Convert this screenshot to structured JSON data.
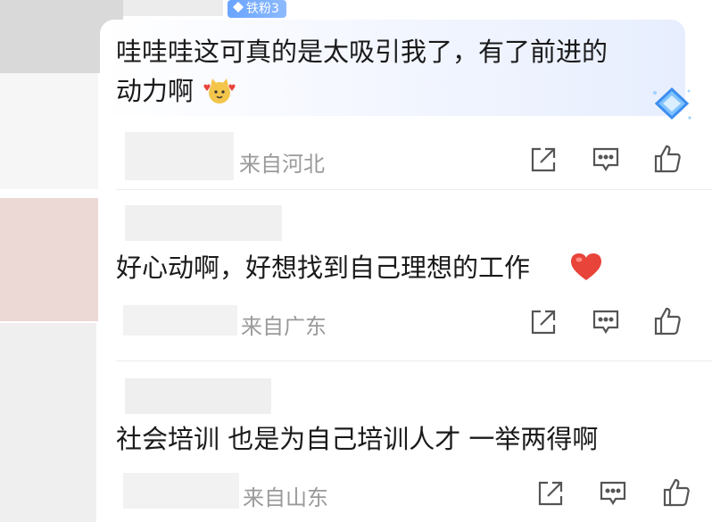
{
  "comments": [
    {
      "badge": "铁粉3",
      "text_line1": "哇哇哇这可真的是太吸引我了，有了前进的",
      "text_line2": "动力啊",
      "emoji": "hugging-cat-emoji",
      "location": "来自河北"
    },
    {
      "text": "好心动啊，好想找到自己理想的工作",
      "emoji": "red-heart-emoji",
      "location": "来自广东"
    },
    {
      "text": "社会培训 也是为自己培训人才 一举两得啊",
      "location": "来自山东"
    }
  ],
  "icons": {
    "share": "share-icon",
    "comment": "comment-icon",
    "like": "thumbs-up-icon"
  },
  "colors": {
    "badge": "#6aa4ff",
    "heart": "#e8443a",
    "secondary_text": "#9a9a9a"
  }
}
